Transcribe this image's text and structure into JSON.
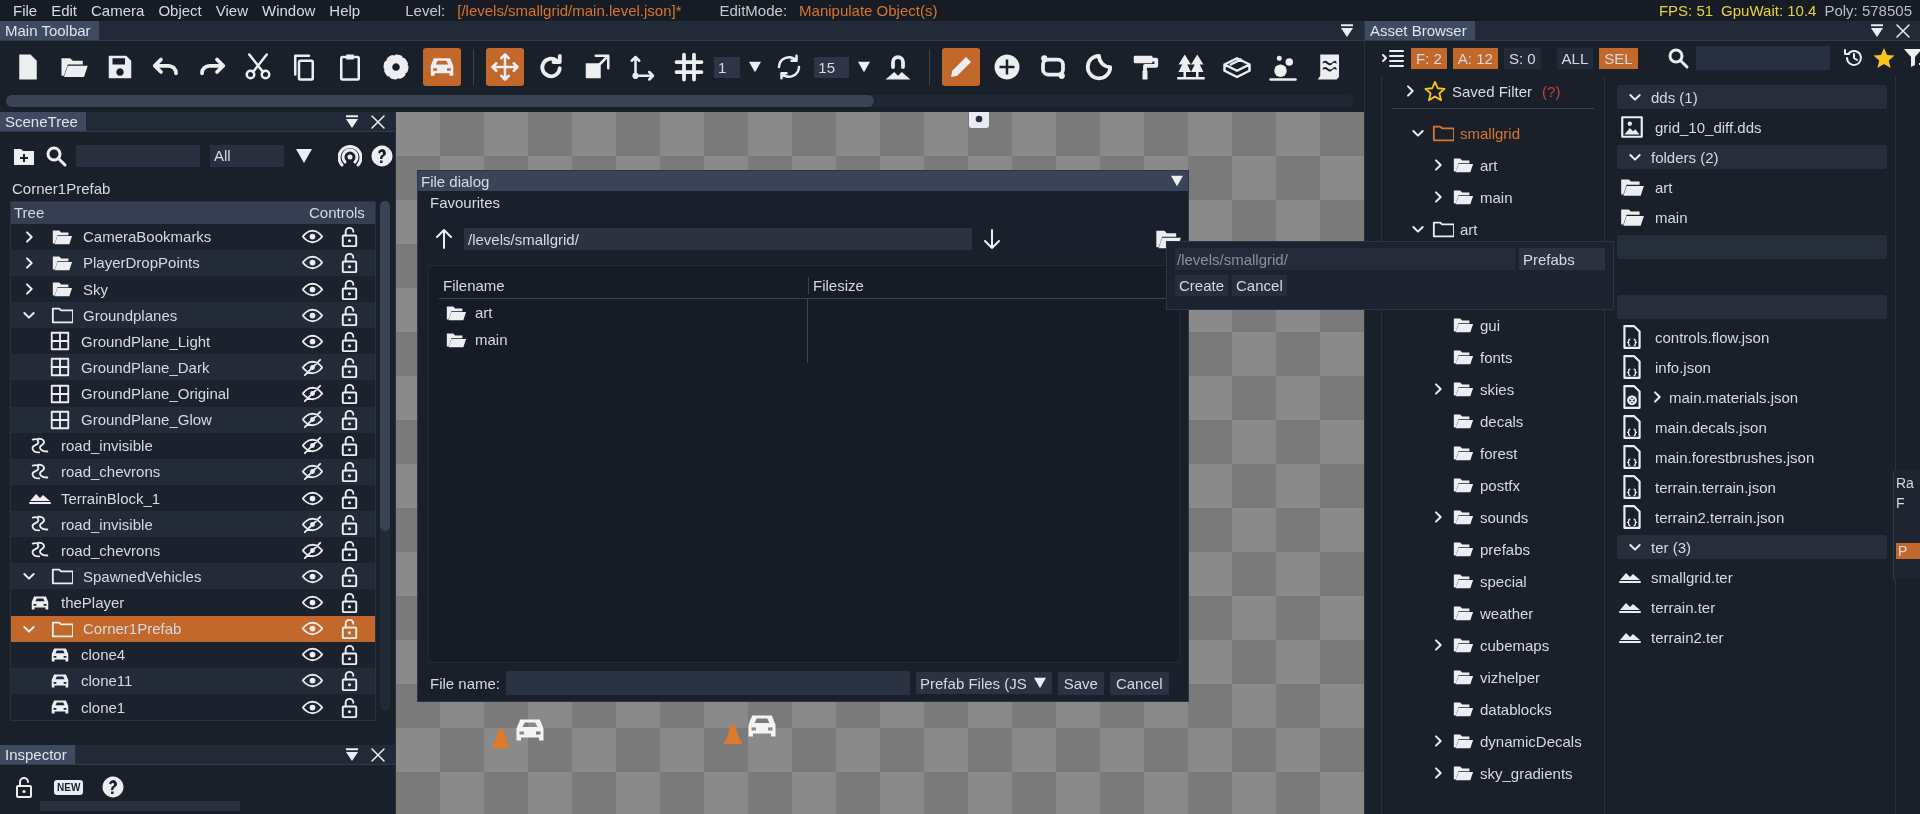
{
  "menu_bar": {
    "items": [
      "File",
      "Edit",
      "Camera",
      "Object",
      "View",
      "Window",
      "Help"
    ],
    "level_label": "Level:",
    "level_value": "[/levels/smallgrid/main.level.json]*",
    "editmode_label": "EditMode:",
    "editmode_value": "Manipulate Object(s)",
    "stats": [
      {
        "text": "FPS: 51",
        "color": "#e2d33c"
      },
      {
        "text": "GpuWait: 10.4",
        "color": "#e2d33c"
      },
      {
        "text": "Poly: 578505",
        "color": "#b9bec8"
      }
    ]
  },
  "toolbar": {
    "title": "Main Toolbar",
    "tools": [
      {
        "kind": "button",
        "selected": false
      },
      {
        "kind": "button",
        "selected": false
      },
      {
        "kind": "button",
        "selected": false
      },
      {
        "kind": "button",
        "selected": false
      },
      {
        "kind": "button",
        "selected": false
      },
      {
        "kind": "button",
        "selected": false
      },
      {
        "kind": "button",
        "selected": false
      },
      {
        "kind": "button",
        "selected": false
      },
      {
        "kind": "button",
        "selected": false
      },
      {
        "kind": "button",
        "selected": true
      },
      {
        "kind": "separator"
      },
      {
        "kind": "button",
        "selected": true
      },
      {
        "kind": "button",
        "selected": false
      },
      {
        "kind": "button",
        "selected": false
      },
      {
        "kind": "button",
        "selected": false
      },
      {
        "kind": "button",
        "selected": false
      },
      {
        "kind": "spinner",
        "value": "1"
      },
      {
        "kind": "button",
        "selected": false
      },
      {
        "kind": "spinner",
        "value": "15"
      },
      {
        "kind": "button",
        "selected": false
      },
      {
        "kind": "separator"
      },
      {
        "kind": "button",
        "selected": true
      },
      {
        "kind": "button",
        "selected": false
      },
      {
        "kind": "button",
        "selected": false
      },
      {
        "kind": "button",
        "selected": false
      },
      {
        "kind": "button",
        "selected": false
      },
      {
        "kind": "button",
        "selected": false
      },
      {
        "kind": "button",
        "selected": false
      },
      {
        "kind": "button",
        "selected": false
      },
      {
        "kind": "button",
        "selected": false
      }
    ]
  },
  "scene_tree": {
    "title": "SceneTree",
    "filter_value": "All",
    "selection_label": "Corner1Prefab",
    "columns": [
      "Tree",
      "Controls"
    ],
    "rows": [
      {
        "kind": "group",
        "name": "CameraBookmarks",
        "expanded": false,
        "visible": true,
        "locked": false,
        "selected": false
      },
      {
        "kind": "group",
        "name": "PlayerDropPoints",
        "expanded": false,
        "visible": true,
        "locked": false,
        "selected": false
      },
      {
        "kind": "group",
        "name": "Sky",
        "expanded": false,
        "visible": true,
        "locked": false,
        "selected": false
      },
      {
        "kind": "group",
        "name": "Groundplanes",
        "expanded": true,
        "visible": true,
        "locked": false,
        "selected": false,
        "children": [
          {
            "kind": "groundplane",
            "name": "GroundPlane_Light",
            "visible": true,
            "locked": false,
            "selected": false
          },
          {
            "kind": "groundplane",
            "name": "GroundPlane_Dark",
            "visible": false,
            "locked": false,
            "selected": false
          },
          {
            "kind": "groundplane",
            "name": "GroundPlane_Original",
            "visible": false,
            "locked": false,
            "selected": false
          },
          {
            "kind": "groundplane",
            "name": "GroundPlane_Glow",
            "visible": false,
            "locked": false,
            "selected": false
          }
        ]
      },
      {
        "kind": "road",
        "name": "road_invisible",
        "visible": false,
        "locked": false,
        "selected": false
      },
      {
        "kind": "road",
        "name": "road_chevrons",
        "visible": false,
        "locked": false,
        "selected": false
      },
      {
        "kind": "terrain",
        "name": "TerrainBlock_1",
        "visible": true,
        "locked": false,
        "selected": false
      },
      {
        "kind": "road",
        "name": "road_invisible",
        "visible": false,
        "locked": false,
        "selected": false
      },
      {
        "kind": "road",
        "name": "road_chevrons",
        "visible": false,
        "locked": false,
        "selected": false
      },
      {
        "kind": "group",
        "name": "SpawnedVehicles",
        "expanded": true,
        "visible": true,
        "locked": false,
        "selected": false
      },
      {
        "kind": "vehicle",
        "name": "thePlayer",
        "visible": true,
        "locked": false,
        "selected": false
      },
      {
        "kind": "group",
        "name": "Corner1Prefab",
        "expanded": true,
        "visible": true,
        "locked": false,
        "selected": true,
        "children": [
          {
            "kind": "vehicle",
            "name": "clone4",
            "visible": true,
            "locked": false,
            "selected": false
          },
          {
            "kind": "vehicle",
            "name": "clone11",
            "visible": true,
            "locked": false,
            "selected": false
          },
          {
            "kind": "vehicle",
            "name": "clone1",
            "visible": true,
            "locked": false,
            "selected": false
          }
        ]
      }
    ]
  },
  "inspector": {
    "title": "Inspector",
    "new_badge": "NEW"
  },
  "file_dialog": {
    "title": "File dialog",
    "favourites": "Favourites",
    "path": "/levels/smallgrid/",
    "columns": [
      "Filename",
      "Filesize"
    ],
    "files": [
      {
        "name": "art"
      },
      {
        "name": "main"
      }
    ],
    "file_name_label": "File name:",
    "file_type": "Prefab Files (JS",
    "buttons": [
      "Save",
      "Cancel"
    ]
  },
  "new_folder_popup": {
    "path_placeholder": "/levels/smallgrid/",
    "name_value": "Prefabs",
    "buttons": [
      "Create",
      "Cancel"
    ]
  },
  "asset_browser": {
    "title": "Asset Browser",
    "chips": [
      {
        "label": "F: 2",
        "selected": true
      },
      {
        "label": "A: 12",
        "selected": true
      },
      {
        "label": "S: 0",
        "selected": false
      },
      {
        "label": "ALL",
        "selected": false
      },
      {
        "label": "SEL",
        "selected": true
      }
    ],
    "saved_filter": "Saved Filter",
    "saved_filter_hint": "(?)",
    "tree": [
      {
        "kind": "folder",
        "name": "smallgrid",
        "expandable": true,
        "expanded": true,
        "selected": true,
        "children": [
          {
            "kind": "folder",
            "name": "art",
            "expandable": true,
            "expanded": false,
            "selected": false
          },
          {
            "kind": "folder",
            "name": "main",
            "expandable": true,
            "expanded": false,
            "selected": false
          }
        ]
      },
      {
        "kind": "folder",
        "name": "art",
        "expandable": true,
        "expanded": true,
        "selected": false,
        "children": [
          {
            "kind": "covered"
          },
          {
            "kind": "covered"
          },
          {
            "kind": "folder",
            "name": "gui",
            "expandable": false,
            "expanded": false,
            "selected": false
          },
          {
            "kind": "folder",
            "name": "fonts",
            "expandable": false,
            "expanded": false,
            "selected": false
          },
          {
            "kind": "folder",
            "name": "skies",
            "expandable": true,
            "expanded": false,
            "selected": false
          },
          {
            "kind": "folder",
            "name": "decals",
            "expandable": false,
            "expanded": false,
            "selected": false
          },
          {
            "kind": "folder",
            "name": "forest",
            "expandable": false,
            "expanded": false,
            "selected": false
          },
          {
            "kind": "folder",
            "name": "postfx",
            "expandable": false,
            "expanded": false,
            "selected": false
          },
          {
            "kind": "folder",
            "name": "sounds",
            "expandable": true,
            "expanded": false,
            "selected": false
          },
          {
            "kind": "folder",
            "name": "prefabs",
            "expandable": false,
            "expanded": false,
            "selected": false
          },
          {
            "kind": "folder",
            "name": "special",
            "expandable": false,
            "expanded": false,
            "selected": false
          },
          {
            "kind": "folder",
            "name": "weather",
            "expandable": false,
            "expanded": false,
            "selected": false
          },
          {
            "kind": "folder",
            "name": "cubemaps",
            "expandable": true,
            "expanded": false,
            "selected": false
          },
          {
            "kind": "folder",
            "name": "vizhelper",
            "expandable": false,
            "expanded": false,
            "selected": false
          },
          {
            "kind": "folder",
            "name": "datablocks",
            "expandable": false,
            "expanded": false,
            "selected": false
          },
          {
            "kind": "folder",
            "name": "dynamicDecals",
            "expandable": true,
            "expanded": false,
            "selected": false
          },
          {
            "kind": "folder",
            "name": "sky_gradients",
            "expandable": true,
            "expanded": false,
            "selected": false
          }
        ]
      }
    ],
    "files": [
      {
        "kind": "header",
        "label": "dds (1)"
      },
      {
        "kind": "image",
        "name": "grid_10_diff.dds"
      },
      {
        "kind": "header",
        "label": "folders (2)"
      },
      {
        "kind": "folder",
        "name": "art"
      },
      {
        "kind": "folder",
        "name": "main"
      },
      {
        "kind": "header"
      },
      {
        "kind": "covered"
      },
      {
        "kind": "header"
      },
      {
        "kind": "json",
        "name": "controls.flow.json"
      },
      {
        "kind": "json",
        "name": "info.json"
      },
      {
        "kind": "material",
        "name": "main.materials.json"
      },
      {
        "kind": "json",
        "name": "main.decals.json"
      },
      {
        "kind": "json",
        "name": "main.forestbrushes.json"
      },
      {
        "kind": "json",
        "name": "terrain.terrain.json"
      },
      {
        "kind": "json",
        "name": "terrain2.terrain.json"
      },
      {
        "kind": "header",
        "label": "ter (3)"
      },
      {
        "kind": "terrain",
        "name": "smallgrid.ter"
      },
      {
        "kind": "terrain",
        "name": "terrain.ter"
      },
      {
        "kind": "terrain",
        "name": "terrain2.ter"
      }
    ],
    "side_strip": {
      "texts": [
        "Ra",
        "F"
      ],
      "tab": "P"
    }
  }
}
